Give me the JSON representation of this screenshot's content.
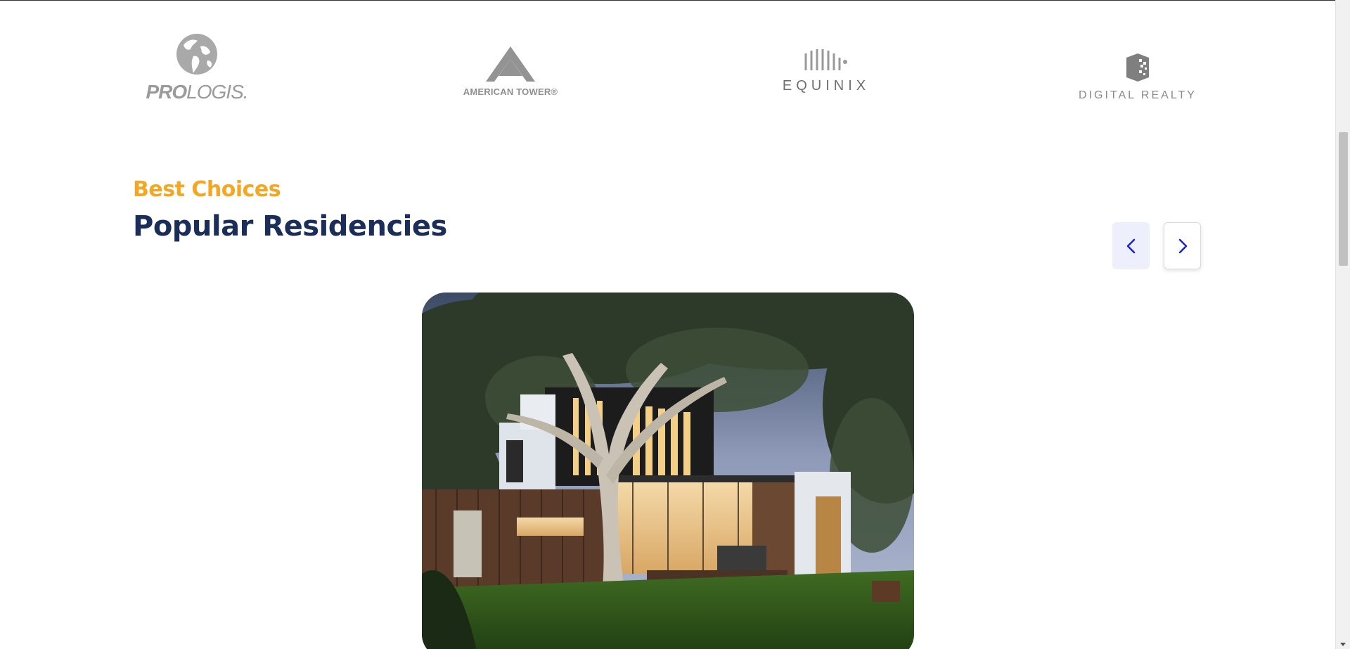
{
  "partners": {
    "logos": [
      {
        "name": "prologis",
        "text_bold": "PRO",
        "text_regular": "LOGIS."
      },
      {
        "name": "american-tower",
        "text": "AMERICAN TOWER®"
      },
      {
        "name": "equinix",
        "text": "EQUINIX"
      },
      {
        "name": "digital-realty",
        "text": "DIGITAL REALTY"
      }
    ]
  },
  "residencies": {
    "eyebrow": "Best Choices",
    "title": "Popular Residencies",
    "nav": {
      "prev_icon": "chevron-left-icon",
      "next_icon": "chevron-right-icon"
    }
  },
  "colors": {
    "accent": "#f5a623",
    "heading": "#1b2d59",
    "nav_icon": "#1f24c9",
    "nav_prev_bg": "#eeeffc"
  }
}
